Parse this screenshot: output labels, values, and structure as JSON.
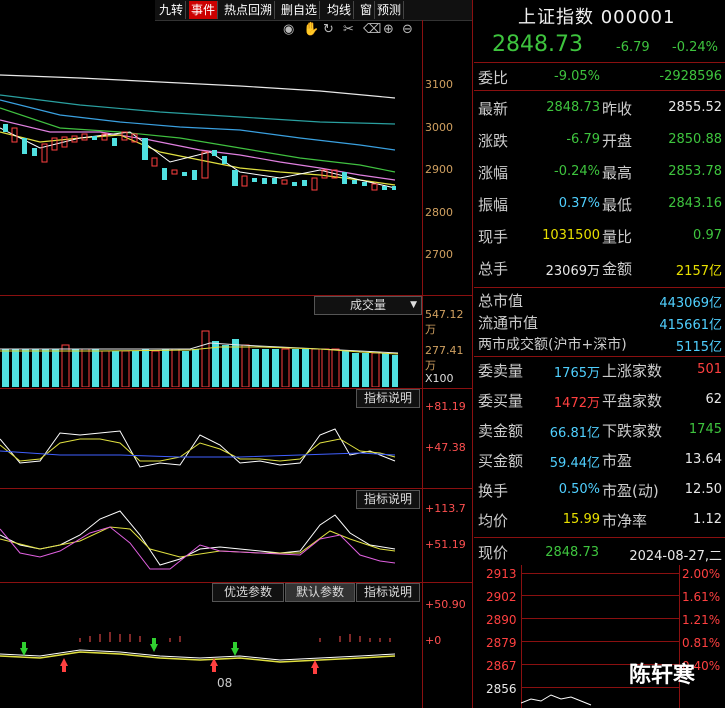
{
  "toolbar": {
    "items": [
      "九转",
      "事件",
      "热点回溯",
      "删自选",
      "均线",
      "窗",
      "预测"
    ],
    "active_index": 1
  },
  "chart_icons": [
    "eye-icon",
    "hand-icon",
    "refresh-icon",
    "scissors-icon",
    "delete-icon",
    "zoom-in-icon",
    "zoom-out-icon"
  ],
  "main_axis": [
    "3100",
    "3000",
    "2900",
    "2800",
    "2700"
  ],
  "volume": {
    "selector": "成交量",
    "top_label": "547.12万",
    "mid_label": "277.41万",
    "unit": "X100"
  },
  "indicator1": {
    "button": "指标说明",
    "top": "+81.19",
    "mid": "+47.38"
  },
  "indicator2": {
    "button": "指标说明",
    "top": "+113.7",
    "mid": "+51.19"
  },
  "indicator3": {
    "btn_optimize": "优选参数",
    "btn_default": "默认参数",
    "btn_help": "指标说明",
    "top": "+50.90",
    "zero": "+0"
  },
  "date_label": "08",
  "quote": {
    "title": "上证指数 000001",
    "price": "2848.73",
    "change": "-6.79",
    "change_pct": "-0.24%",
    "weibi_label": "委比",
    "weibi_pct": "-9.05%",
    "weibi_val": "-2928596"
  },
  "stats_rows": [
    {
      "l1": "最新",
      "v1": "2848.73",
      "c1": "green",
      "l2": "昨收",
      "v2": "2855.52",
      "c2": "white"
    },
    {
      "l1": "涨跌",
      "v1": "-6.79",
      "c1": "green",
      "l2": "开盘",
      "v2": "2850.88",
      "c2": "green"
    },
    {
      "l1": "涨幅",
      "v1": "-0.24%",
      "c1": "green",
      "l2": "最高",
      "v2": "2853.78",
      "c2": "green"
    },
    {
      "l1": "振幅",
      "v1": "0.37%",
      "c1": "cyan",
      "l2": "最低",
      "v2": "2843.16",
      "c2": "green"
    },
    {
      "l1": "现手",
      "v1": "1031500",
      "c1": "yellow",
      "l2": "量比",
      "v2": "0.97",
      "c2": "green"
    },
    {
      "l1": "总手",
      "v1": "23069万",
      "c1": "white",
      "l2": "金额",
      "v2": "2157亿",
      "c2": "yellow"
    }
  ],
  "market_rows": [
    {
      "label": "总市值",
      "value": "443069亿"
    },
    {
      "label": "流通市值",
      "value": "415661亿"
    },
    {
      "label": "两市成交额(沪市+深市)",
      "value": "5115亿"
    }
  ],
  "breadth_rows": [
    {
      "l1": "委卖量",
      "v1": "1765万",
      "c1": "cyan",
      "l2": "上涨家数",
      "v2": "501",
      "c2": "red"
    },
    {
      "l1": "委买量",
      "v1": "1472万",
      "c1": "red",
      "l2": "平盘家数",
      "v2": "62",
      "c2": "white"
    },
    {
      "l1": "卖金额",
      "v1": "66.81亿",
      "c1": "cyan",
      "l2": "下跌家数",
      "v2": "1745",
      "c2": "green"
    },
    {
      "l1": "买金额",
      "v1": "59.44亿",
      "c1": "cyan",
      "l2": "市盈",
      "v2": "13.64",
      "c2": "white"
    },
    {
      "l1": "换手",
      "v1": "0.50%",
      "c1": "cyan",
      "l2": "市盈(动)",
      "v2": "12.50",
      "c2": "white"
    },
    {
      "l1": "均价",
      "v1": "15.99",
      "c1": "yellow",
      "l2": "市净率",
      "v2": "1.12",
      "c2": "white"
    }
  ],
  "intraday": {
    "label": "现价",
    "price": "2848.73",
    "datetime": "2024-08-27,二",
    "left_axis": [
      "2913",
      "2902",
      "2890",
      "2879",
      "2867",
      "2856"
    ],
    "right_axis": [
      "2.00%",
      "1.61%",
      "1.21%",
      "0.81%",
      "0.40%"
    ]
  },
  "watermark": "陈轩寒"
}
